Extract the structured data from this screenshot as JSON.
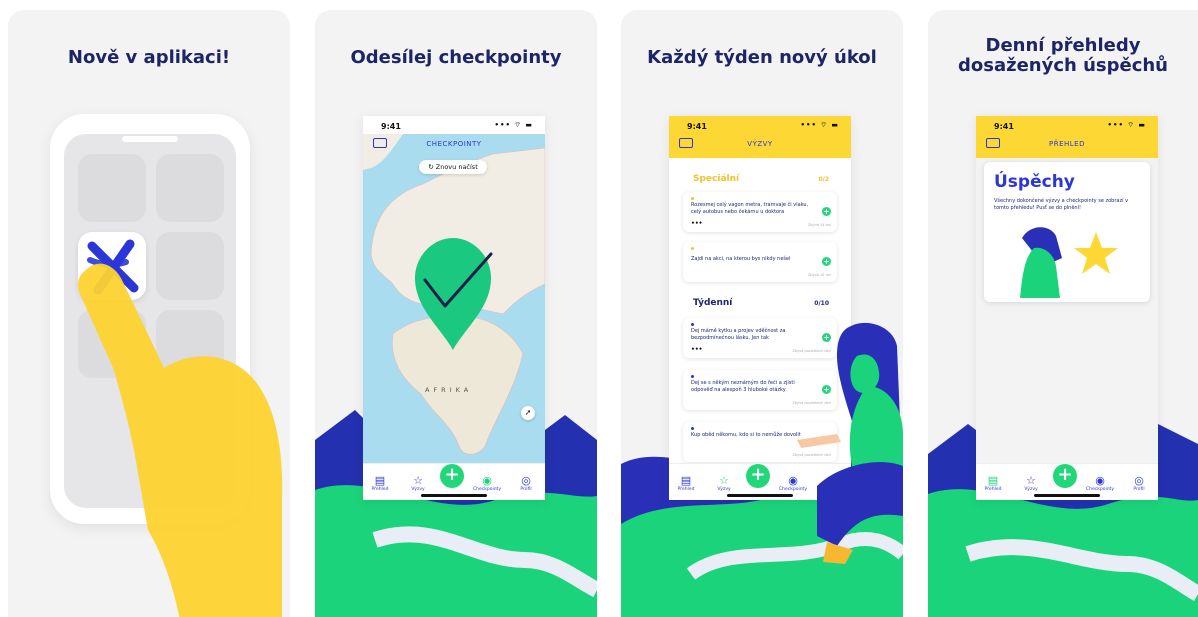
{
  "cards": [
    {
      "title": "Nově v aplikaci!"
    },
    {
      "title": "Odesílej checkpointy"
    },
    {
      "title": "Každý týden nový úkol"
    },
    {
      "title_lines": [
        "Denní přehledy",
        "dosažených úspěchů"
      ]
    }
  ],
  "status": {
    "time_map": "9:41",
    "time": "9:41",
    "signal": "••• ⌔ ▬"
  },
  "map_screen": {
    "nav_title": "CHECKPOINTY",
    "reload_label": "↻ Znovu načíst",
    "continent_label": "AFRIKA"
  },
  "tasks_screen": {
    "nav_title": "VÝZVY",
    "special": {
      "title": "Speciální",
      "count": "0/2"
    },
    "weekly": {
      "title": "Týdenní",
      "count": "0/10"
    },
    "special_tasks": [
      {
        "text": "Rozesmej celý vagon metra, tramvaje či vlaku, celý autobus nebo čekárnu u doktora",
        "remaining": "Zbývá 14 dní"
      },
      {
        "text": "Zajdi na akci, na kterou bys nikdy nešel",
        "remaining": "Zbývá 14 dní"
      }
    ],
    "weekly_tasks": [
      {
        "text": "Dej mámě kytku a projev vděčnost za bezpodmínečnou lásku. Jen tak",
        "remaining": "Zbývá posledních den"
      },
      {
        "text": "Dej se s někým neznámým do řeči a zjisti odpověď na alespoň 3 hluboké otázky",
        "remaining": "Zbývá posledních den"
      },
      {
        "text": "Kup oběd někomu, kdo si to nemůže dovolit",
        "remaining": "Zbývá posledních den"
      }
    ],
    "more": "•••"
  },
  "overview_screen": {
    "nav_title": "PŘEHLED",
    "title": "Úspěchy",
    "description": "Všechny dokončené výzvy a checkpointy se zobrazí v tomto přehledu! Pusť se do plnění!"
  },
  "tabbar": {
    "overview": "Přehled",
    "challenges": "Výzvy",
    "add": "+",
    "checkpoints": "Checkpointy",
    "profile": "Profil"
  },
  "icons": {
    "app": "x-logo-icon",
    "mail": "mail-icon",
    "pin": "checkmark-pin-icon",
    "trophy": "star-trophy-icon"
  },
  "colors": {
    "brand_blue": "#2b36d9",
    "green": "#22d67a",
    "yellow": "#fdd835",
    "navy": "#1c2566"
  }
}
